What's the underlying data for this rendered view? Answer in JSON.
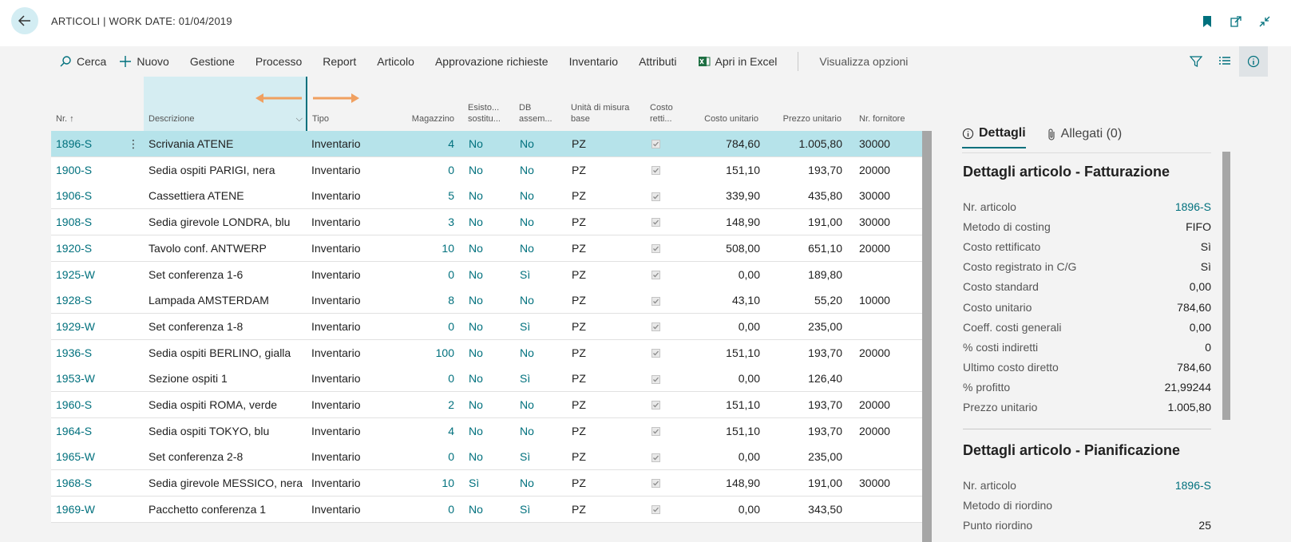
{
  "header": {
    "title": "ARTICOLI | WORK DATE: 01/04/2019",
    "icons": [
      "back-arrow-icon",
      "bookmark-icon",
      "open-new-window-icon",
      "collapse-icon"
    ]
  },
  "toolbar": {
    "search": "Cerca",
    "new": "Nuovo",
    "manage": "Gestione",
    "process": "Processo",
    "report": "Report",
    "item": "Articolo",
    "approvals": "Approvazione richieste",
    "inventory": "Inventario",
    "attributes": "Attributi",
    "excel": "Apri in Excel",
    "view_options": "Visualizza opzioni"
  },
  "columns": {
    "no": "Nr.",
    "description": "Descrizione",
    "type": "Tipo",
    "stock": "Magazzino",
    "substitutes": "Esisto... sostitu...",
    "assembly_bom": "DB assem...",
    "base_uom": "Unità di misura base",
    "cost_adjusted": "Costo retti...",
    "unit_cost": "Costo unitario",
    "unit_price": "Prezzo unitario",
    "vendor_no": "Nr. fornitore"
  },
  "rows": [
    {
      "no": "1896-S",
      "desc": "Scrivania ATENE",
      "type": "Inventario",
      "stock": "4",
      "subst": "No",
      "bom": "No",
      "uom": "PZ",
      "cost": "784,60",
      "price": "1.005,80",
      "vendor": "30000"
    },
    {
      "no": "1900-S",
      "desc": "Sedia ospiti PARIGI, nera",
      "type": "Inventario",
      "stock": "0",
      "subst": "No",
      "bom": "No",
      "uom": "PZ",
      "cost": "151,10",
      "price": "193,70",
      "vendor": "20000"
    },
    {
      "no": "1906-S",
      "desc": "Cassettiera ATENE",
      "type": "Inventario",
      "stock": "5",
      "subst": "No",
      "bom": "No",
      "uom": "PZ",
      "cost": "339,90",
      "price": "435,80",
      "vendor": "30000"
    },
    {
      "no": "1908-S",
      "desc": "Sedia girevole LONDRA, blu",
      "type": "Inventario",
      "stock": "3",
      "subst": "No",
      "bom": "No",
      "uom": "PZ",
      "cost": "148,90",
      "price": "191,00",
      "vendor": "30000"
    },
    {
      "no": "1920-S",
      "desc": "Tavolo conf. ANTWERP",
      "type": "Inventario",
      "stock": "10",
      "subst": "No",
      "bom": "No",
      "uom": "PZ",
      "cost": "508,00",
      "price": "651,10",
      "vendor": "20000"
    },
    {
      "no": "1925-W",
      "desc": "Set conferenza 1-6",
      "type": "Inventario",
      "stock": "0",
      "subst": "No",
      "bom": "Sì",
      "uom": "PZ",
      "cost": "0,00",
      "price": "189,80",
      "vendor": ""
    },
    {
      "no": "1928-S",
      "desc": "Lampada AMSTERDAM",
      "type": "Inventario",
      "stock": "8",
      "subst": "No",
      "bom": "No",
      "uom": "PZ",
      "cost": "43,10",
      "price": "55,20",
      "vendor": "10000"
    },
    {
      "no": "1929-W",
      "desc": "Set conferenza 1-8",
      "type": "Inventario",
      "stock": "0",
      "subst": "No",
      "bom": "Sì",
      "uom": "PZ",
      "cost": "0,00",
      "price": "235,00",
      "vendor": ""
    },
    {
      "no": "1936-S",
      "desc": "Sedia ospiti BERLINO, gialla",
      "type": "Inventario",
      "stock": "100",
      "subst": "No",
      "bom": "No",
      "uom": "PZ",
      "cost": "151,10",
      "price": "193,70",
      "vendor": "20000"
    },
    {
      "no": "1953-W",
      "desc": "Sezione ospiti 1",
      "type": "Inventario",
      "stock": "0",
      "subst": "No",
      "bom": "Sì",
      "uom": "PZ",
      "cost": "0,00",
      "price": "126,40",
      "vendor": ""
    },
    {
      "no": "1960-S",
      "desc": "Sedia ospiti ROMA, verde",
      "type": "Inventario",
      "stock": "2",
      "subst": "No",
      "bom": "No",
      "uom": "PZ",
      "cost": "151,10",
      "price": "193,70",
      "vendor": "20000"
    },
    {
      "no": "1964-S",
      "desc": "Sedia ospiti TOKYO, blu",
      "type": "Inventario",
      "stock": "4",
      "subst": "No",
      "bom": "No",
      "uom": "PZ",
      "cost": "151,10",
      "price": "193,70",
      "vendor": "20000"
    },
    {
      "no": "1965-W",
      "desc": "Set conferenza 2-8",
      "type": "Inventario",
      "stock": "0",
      "subst": "No",
      "bom": "Sì",
      "uom": "PZ",
      "cost": "0,00",
      "price": "235,00",
      "vendor": ""
    },
    {
      "no": "1968-S",
      "desc": "Sedia girevole MESSICO, nera",
      "type": "Inventario",
      "stock": "10",
      "subst": "Sì",
      "bom": "No",
      "uom": "PZ",
      "cost": "148,90",
      "price": "191,00",
      "vendor": "30000"
    },
    {
      "no": "1969-W",
      "desc": "Pacchetto conferenza 1",
      "type": "Inventario",
      "stock": "0",
      "subst": "No",
      "bom": "Sì",
      "uom": "PZ",
      "cost": "0,00",
      "price": "343,50",
      "vendor": ""
    }
  ],
  "panel": {
    "tab_details": "Dettagli",
    "tab_attachments": "Allegati (0)",
    "section1_title": "Dettagli articolo - Fatturazione",
    "section1": [
      {
        "label": "Nr. articolo",
        "value": "1896-S",
        "link": true
      },
      {
        "label": "Metodo di costing",
        "value": "FIFO"
      },
      {
        "label": "Costo rettificato",
        "value": "Sì"
      },
      {
        "label": "Costo registrato in C/G",
        "value": "Sì"
      },
      {
        "label": "Costo standard",
        "value": "0,00"
      },
      {
        "label": "Costo unitario",
        "value": "784,60"
      },
      {
        "label": "Coeff. costi generali",
        "value": "0,00"
      },
      {
        "label": "% costi indiretti",
        "value": "0"
      },
      {
        "label": "Ultimo costo diretto",
        "value": "784,60"
      },
      {
        "label": "% profitto",
        "value": "21,99244"
      },
      {
        "label": "Prezzo unitario",
        "value": "1.005,80"
      }
    ],
    "section2_title": "Dettagli articolo - Pianificazione",
    "section2": [
      {
        "label": "Nr. articolo",
        "value": "1896-S",
        "link": true
      },
      {
        "label": "Metodo di riordino",
        "value": ""
      },
      {
        "label": "Punto riordino",
        "value": "25"
      }
    ]
  }
}
